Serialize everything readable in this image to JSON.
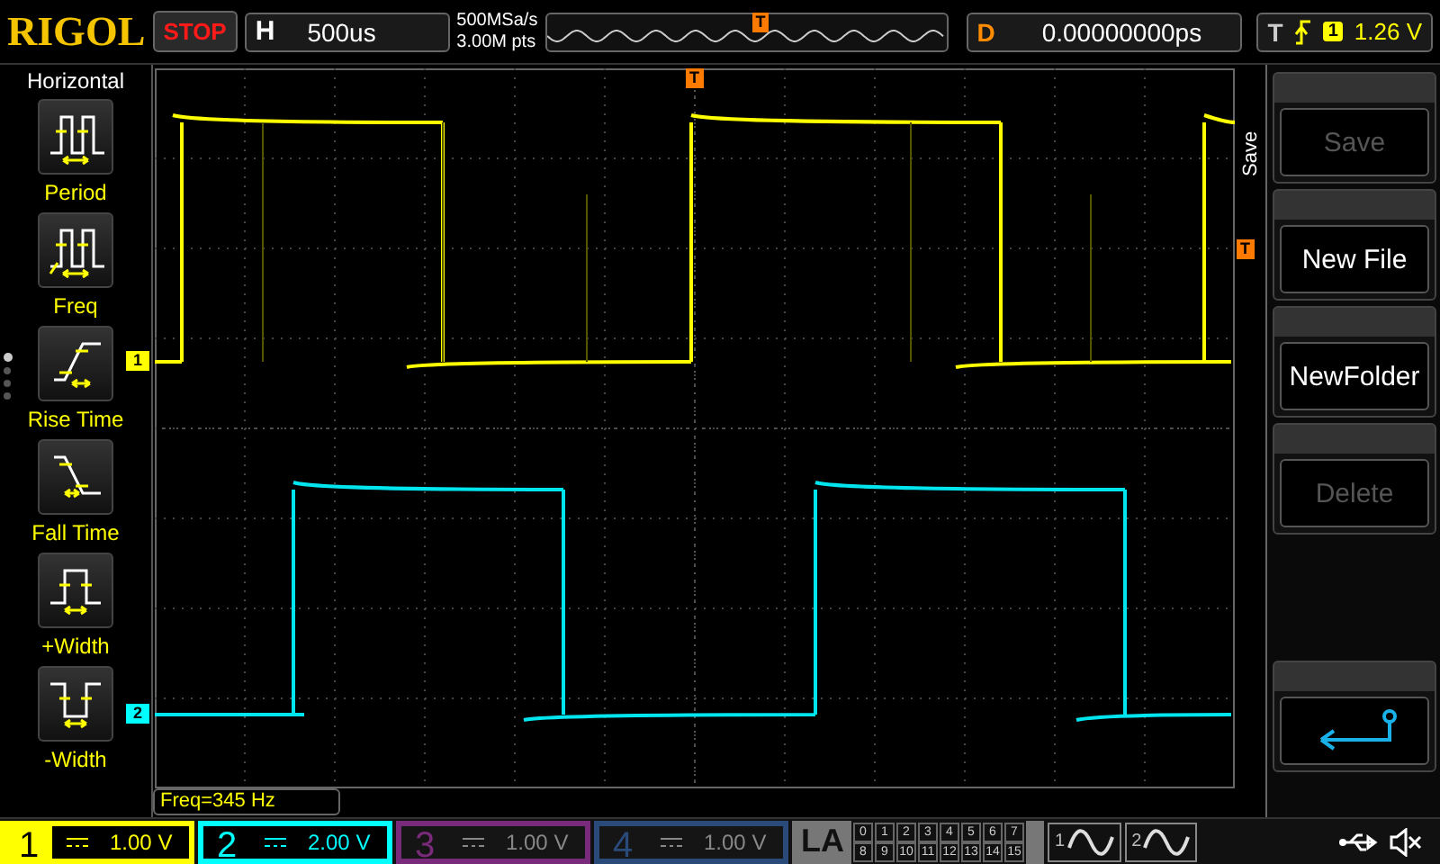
{
  "brand": "RIGOL",
  "run_state": "STOP",
  "timebase": {
    "label": "H",
    "value": "500us"
  },
  "sampling": {
    "rate": "500MSa/s",
    "depth": "3.00M pts"
  },
  "memory_marker": "T",
  "delay": {
    "label": "D",
    "value": "0.00000000ps"
  },
  "trigger": {
    "label": "T",
    "source": "1",
    "level": "1.26 V"
  },
  "measure_menu": {
    "title": "Horizontal",
    "items": [
      {
        "label": "Period",
        "kind": "period"
      },
      {
        "label": "Freq",
        "kind": "freq"
      },
      {
        "label": "Rise Time",
        "kind": "rise"
      },
      {
        "label": "Fall Time",
        "kind": "fall"
      },
      {
        "label": "+Width",
        "kind": "pwidth"
      },
      {
        "label": "-Width",
        "kind": "nwidth"
      }
    ]
  },
  "menu_pages": [
    {
      "selected": true
    },
    {
      "selected": false
    },
    {
      "selected": false
    },
    {
      "selected": false
    }
  ],
  "grid": {
    "trigger_marker": "T",
    "trigger_level_marker": "T",
    "channel_markers": [
      {
        "label": "1",
        "color": "#ffff00"
      },
      {
        "label": "2",
        "color": "#00ffff"
      }
    ]
  },
  "softkey_menu": {
    "title": "Save",
    "buttons": [
      {
        "kind": "text",
        "label": "Save",
        "disabled": true
      },
      {
        "kind": "text",
        "label": "New File",
        "disabled": false
      },
      {
        "kind": "text",
        "label": "NewFolder",
        "disabled": false
      },
      {
        "kind": "text",
        "label": "Delete",
        "disabled": true
      },
      {
        "kind": "gap"
      },
      {
        "kind": "back"
      }
    ]
  },
  "measurement": "Freq=345 Hz",
  "channels": [
    {
      "number": "1",
      "scale": "1.00 V",
      "on": true,
      "color": "#ffff00"
    },
    {
      "number": "2",
      "scale": "2.00 V",
      "on": true,
      "color": "#00ffff"
    },
    {
      "number": "3",
      "scale": "1.00 V",
      "on": false,
      "color": "#7a2a7a"
    },
    {
      "number": "4",
      "scale": "1.00 V",
      "on": false,
      "color": "#2a4a7a"
    }
  ],
  "logic_analyzer": {
    "label": "LA",
    "digital_channels": [
      "0",
      "1",
      "2",
      "3",
      "4",
      "5",
      "6",
      "7",
      "8",
      "9",
      "10",
      "11",
      "12",
      "13",
      "14",
      "15"
    ]
  },
  "generators": [
    {
      "number": "1"
    },
    {
      "number": "2"
    }
  ]
}
